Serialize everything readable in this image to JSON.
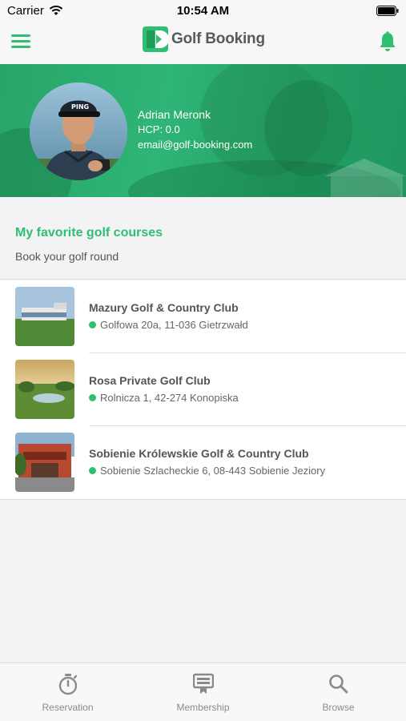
{
  "status_bar": {
    "carrier": "Carrier",
    "time": "10:54 AM"
  },
  "header": {
    "app_title": "Golf Booking"
  },
  "profile": {
    "name": "Adrian Meronk",
    "hcp": "HCP: 0.0",
    "email": "email@golf-booking.com"
  },
  "favorites": {
    "title": "My favorite golf courses",
    "subtitle": "Book your golf round",
    "items": [
      {
        "name": "Mazury Golf & Country Club",
        "address": "Golfowa 20a, 11-036 Gietrzwałd"
      },
      {
        "name": "Rosa Private Golf Club",
        "address": "Rolnicza 1, 42-274 Konopiska"
      },
      {
        "name": "Sobienie Królewskie Golf & Country Club",
        "address": "Sobienie Szlacheckie 6, 08-443 Sobienie Jeziory"
      }
    ]
  },
  "tabs": [
    {
      "label": "Reservation",
      "icon": "stopwatch-icon"
    },
    {
      "label": "Membership",
      "icon": "membership-card-icon"
    },
    {
      "label": "Browse",
      "icon": "search-icon"
    }
  ],
  "colors": {
    "accent": "#2fbf71",
    "header_green": "#2fb577",
    "status_dot": "#2fbf71"
  }
}
